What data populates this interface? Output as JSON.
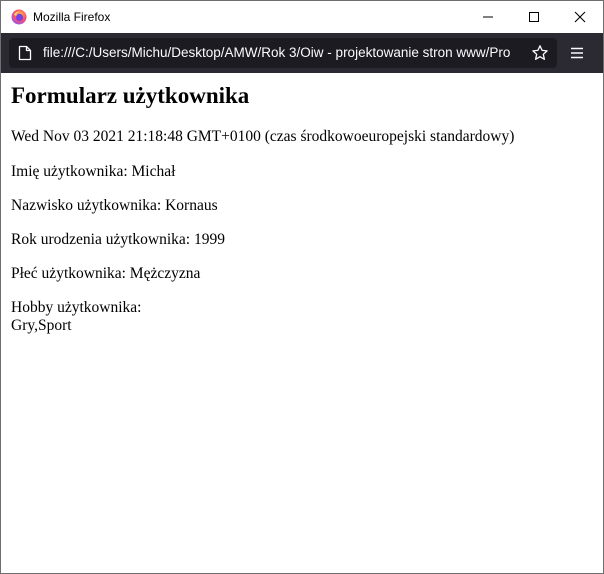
{
  "window": {
    "title": "Mozilla Firefox",
    "browser_icon": "firefox-logo-icon",
    "controls": [
      "minimize-icon",
      "maximize-icon",
      "close-icon"
    ]
  },
  "toolbar": {
    "url": "file:///C:/Users/Michu/Desktop/AMW/Rok 3/Oiw - projektowanie stron www/Pro",
    "page_icon": "page-icon",
    "bookmark_icon": "star-icon",
    "menu_icon": "hamburger-menu-icon"
  },
  "page": {
    "heading": "Formularz użytkownika",
    "date": "Wed Nov 03 2021 21:18:48 GMT+0100 (czas środkowoeuropejski standardowy)",
    "first_name": "Imię użytkownika: Michał",
    "last_name": "Nazwisko użytkownika: Kornaus",
    "birth_year": "Rok urodzenia użytkownika: 1999",
    "gender": "Płeć użytkownika: Mężczyzna",
    "hobby_label": "Hobby użytkownika:",
    "hobby_value": "Gry,Sport"
  },
  "colors": {
    "toolbar_bg": "#2b2a33",
    "urlbar_bg": "#1c1b22",
    "url_text": "#fbfbfe"
  }
}
